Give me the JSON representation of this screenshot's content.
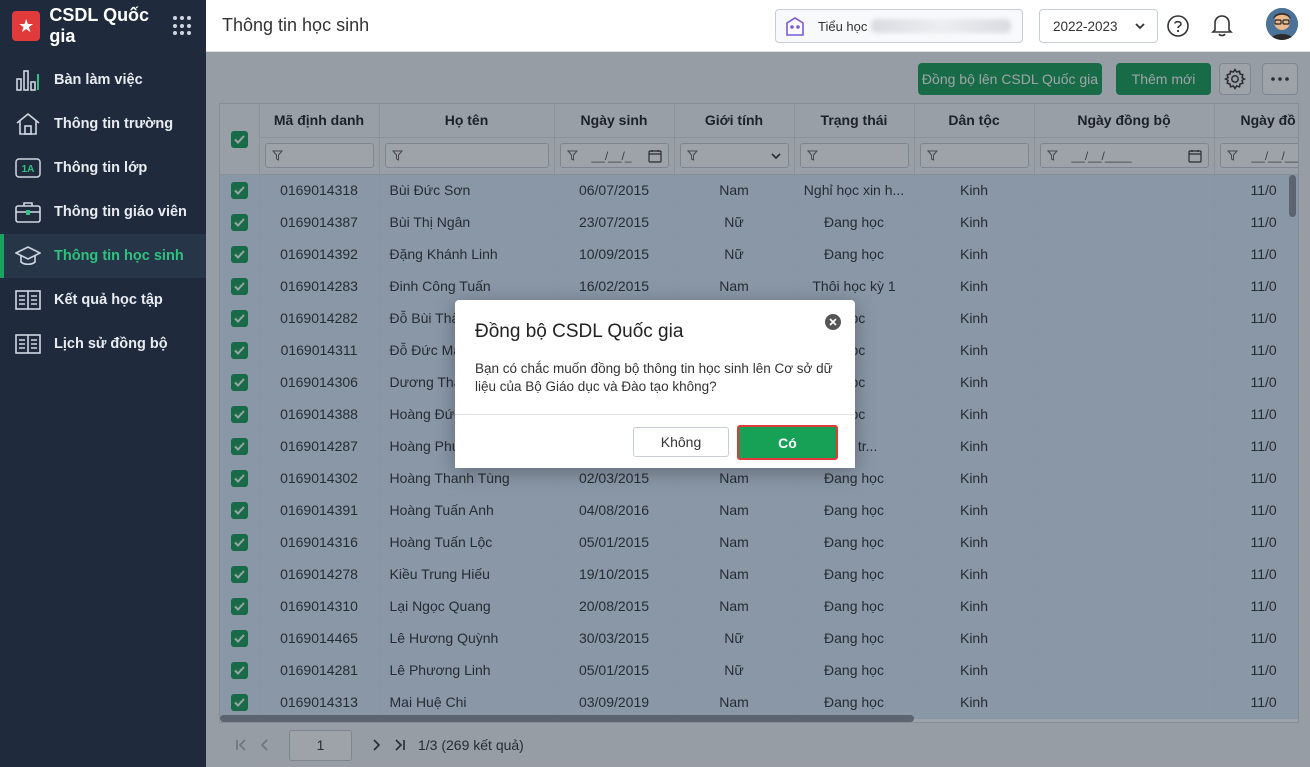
{
  "app": {
    "title": "CSDL Quốc gia"
  },
  "sidebar": {
    "items": [
      {
        "label": "Bàn làm việc",
        "icon": "chart-bars-icon"
      },
      {
        "label": "Thông tin trường",
        "icon": "school-house-icon"
      },
      {
        "label": "Thông tin lớp",
        "icon": "class-1a-icon"
      },
      {
        "label": "Thông tin giáo viên",
        "icon": "briefcase-icon"
      },
      {
        "label": "Thông tin học sinh",
        "icon": "graduation-cap-icon",
        "active": true
      },
      {
        "label": "Kết quả học tập",
        "icon": "book-open-icon"
      },
      {
        "label": "Lịch sử đồng bộ",
        "icon": "book-history-icon"
      }
    ]
  },
  "header": {
    "page_title": "Thông tin học sinh",
    "school_prefix": "Tiểu học",
    "year": "2022-2023"
  },
  "toolbar": {
    "sync_label": "Đồng bộ lên CSDL Quốc gia",
    "add_label": "Thêm mới"
  },
  "table": {
    "columns": [
      "Mã định danh",
      "Họ tên",
      "Ngày sinh",
      "Giới tính",
      "Trạng thái",
      "Dân tộc",
      "Ngày đồng bộ",
      "Ngày đồ"
    ],
    "date_placeholder": "__/__/____",
    "date_placeholder_short": "__/__/_",
    "rows": [
      [
        "0169014318",
        "Bùi Đức Sơn",
        "06/07/2015",
        "Nam",
        "Nghỉ học xin h...",
        "Kinh",
        "",
        "11/0"
      ],
      [
        "0169014387",
        "Bùi Thị Ngân",
        "23/07/2015",
        "Nữ",
        "Đang học",
        "Kinh",
        "",
        "11/0"
      ],
      [
        "0169014392",
        "Đặng Khánh Linh",
        "10/09/2015",
        "Nữ",
        "Đang học",
        "Kinh",
        "",
        "11/0"
      ],
      [
        "0169014283",
        "Đinh Công Tuấn",
        "16/02/2015",
        "Nam",
        "Thôi học kỳ 1",
        "Kinh",
        "",
        "11/0"
      ],
      [
        "0169014282",
        "Đỗ Bùi Thà",
        "",
        "",
        "học",
        "Kinh",
        "",
        "11/0"
      ],
      [
        "0169014311",
        "Đỗ Đức Mạ",
        "",
        "",
        "học",
        "Kinh",
        "",
        "11/0"
      ],
      [
        "0169014306",
        "Dương Thá",
        "",
        "",
        "học",
        "Kinh",
        "",
        "11/0"
      ],
      [
        "0169014388",
        "Hoàng Đức",
        "",
        "",
        "học",
        "Kinh",
        "",
        "11/0"
      ],
      [
        "0169014287",
        "Hoàng Phu",
        "",
        "",
        "đến tr...",
        "Kinh",
        "",
        "11/0"
      ],
      [
        "0169014302",
        "Hoàng Thanh Tùng",
        "02/03/2015",
        "Nam",
        "Đang học",
        "Kinh",
        "",
        "11/0"
      ],
      [
        "0169014391",
        "Hoàng Tuấn Anh",
        "04/08/2016",
        "Nam",
        "Đang học",
        "Kinh",
        "",
        "11/0"
      ],
      [
        "0169014316",
        "Hoàng Tuấn Lộc",
        "05/01/2015",
        "Nam",
        "Đang học",
        "Kinh",
        "",
        "11/0"
      ],
      [
        "0169014278",
        "Kiều Trung Hiếu",
        "19/10/2015",
        "Nam",
        "Đang học",
        "Kinh",
        "",
        "11/0"
      ],
      [
        "0169014310",
        "Lại Ngọc Quang",
        "20/08/2015",
        "Nam",
        "Đang học",
        "Kinh",
        "",
        "11/0"
      ],
      [
        "0169014465",
        "Lê Hương Quỳnh",
        "30/03/2015",
        "Nữ",
        "Đang học",
        "Kinh",
        "",
        "11/0"
      ],
      [
        "0169014281",
        "Lê Phương Linh",
        "05/01/2015",
        "Nữ",
        "Đang học",
        "Kinh",
        "",
        "11/0"
      ],
      [
        "0169014313",
        "Mai Huệ Chi",
        "03/09/2019",
        "Nam",
        "Đang học",
        "Kinh",
        "",
        "11/0"
      ]
    ]
  },
  "pager": {
    "page": "1",
    "summary": "1/3 (269 kết quả)"
  },
  "dialog": {
    "title": "Đồng bộ CSDL Quốc gia",
    "body": "Bạn có chắc muốn đồng bộ thông tin học sinh lên Cơ sở dữ liệu của Bộ Giáo dục và Đào tạo không?",
    "no_label": "Không",
    "yes_label": "Có"
  },
  "colors": {
    "sidebar": "#1f2b3d",
    "accent": "#17a157",
    "selected_row": "#dbeafb",
    "highlight_border": "#e03a3a"
  }
}
